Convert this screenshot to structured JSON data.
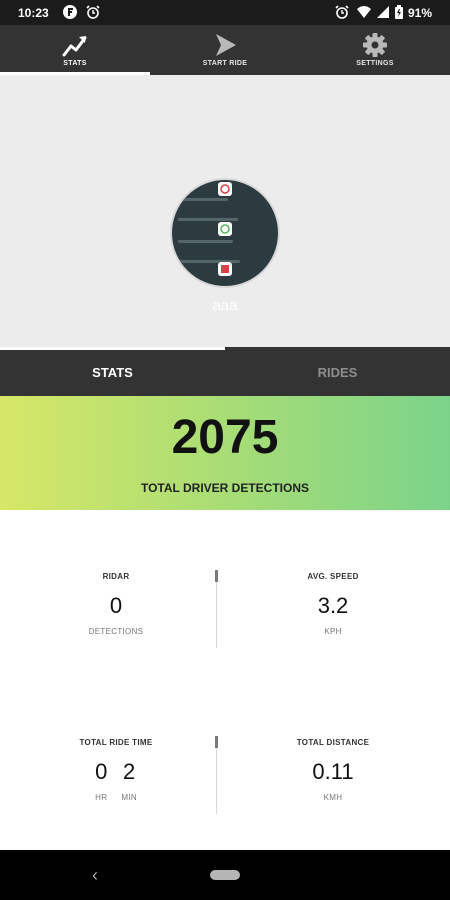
{
  "status_bar": {
    "time": "10:23",
    "battery_percent": "91%"
  },
  "top_nav": {
    "tabs": [
      {
        "label": "STATS",
        "icon": "trend-up-icon",
        "active": true
      },
      {
        "label": "START RIDE",
        "icon": "play-icon",
        "active": false
      },
      {
        "label": "SETTINGS",
        "icon": "gear-icon",
        "active": false
      }
    ]
  },
  "profile": {
    "username": "aaa"
  },
  "sub_tabs": {
    "stats": "STATS",
    "rides": "RIDES"
  },
  "banner": {
    "count": "2075",
    "label": "TOTAL DRIVER DETECTIONS"
  },
  "stats": {
    "ridar": {
      "label": "RIDAR",
      "value": "0",
      "unit": "DETECTIONS"
    },
    "avg_speed": {
      "label": "AVG. SPEED",
      "value": "3.2",
      "unit": "KPH"
    },
    "total_ride_time": {
      "label": "TOTAL RIDE TIME",
      "hours": "0",
      "minutes": "2",
      "hours_unit": "HR",
      "minutes_unit": "MIN"
    },
    "total_distance": {
      "label": "TOTAL DISTANCE",
      "value": "0.11",
      "unit": "KMH"
    }
  },
  "colors": {
    "nav_bg": "#333333",
    "banner_start": "#d7e767",
    "banner_end": "#7bd38a"
  }
}
